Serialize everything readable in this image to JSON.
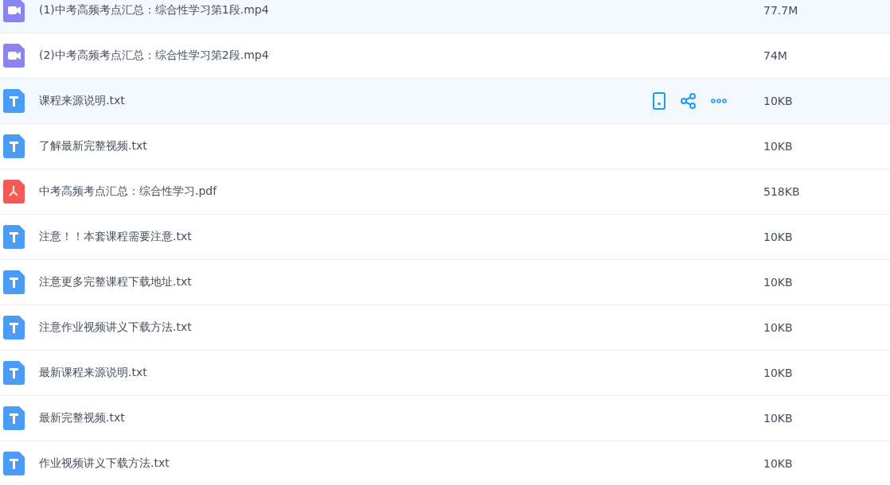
{
  "files": [
    {
      "kind": "video",
      "name": "(1)中考高频考点汇总：综合性学习第1段.mp4",
      "size": "77.7M",
      "highlighted": true,
      "show_actions": false
    },
    {
      "kind": "video",
      "name": "(2)中考高频考点汇总：综合性学习第2段.mp4",
      "size": "74M",
      "highlighted": false,
      "show_actions": false
    },
    {
      "kind": "text",
      "name": "课程来源说明.txt",
      "size": "10KB",
      "highlighted": true,
      "show_actions": true
    },
    {
      "kind": "text",
      "name": "了解最新完整视频.txt",
      "size": "10KB",
      "highlighted": false,
      "show_actions": false
    },
    {
      "kind": "pdf",
      "name": "中考高频考点汇总：综合性学习.pdf",
      "size": "518KB",
      "highlighted": false,
      "show_actions": false
    },
    {
      "kind": "text",
      "name": "注意！！本套课程需要注意.txt",
      "size": "10KB",
      "highlighted": false,
      "show_actions": false
    },
    {
      "kind": "text",
      "name": "注意更多完整课程下载地址.txt",
      "size": "10KB",
      "highlighted": false,
      "show_actions": false
    },
    {
      "kind": "text",
      "name": "注意作业视频讲义下载方法.txt",
      "size": "10KB",
      "highlighted": false,
      "show_actions": false
    },
    {
      "kind": "text",
      "name": "最新课程来源说明.txt",
      "size": "10KB",
      "highlighted": false,
      "show_actions": false
    },
    {
      "kind": "text",
      "name": "最新完整视频.txt",
      "size": "10KB",
      "highlighted": false,
      "show_actions": false
    },
    {
      "kind": "text",
      "name": "作业视频讲义下载方法.txt",
      "size": "10KB",
      "highlighted": false,
      "show_actions": false
    }
  ]
}
